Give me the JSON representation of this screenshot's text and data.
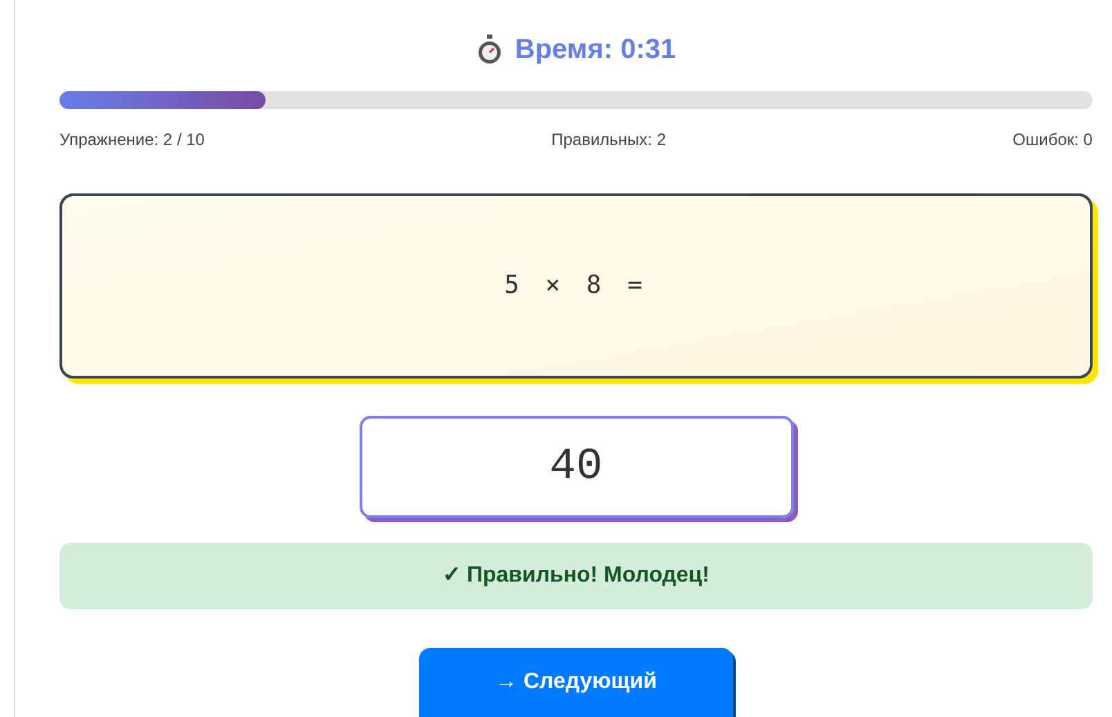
{
  "timer": {
    "text": "Время: 0:31"
  },
  "progress": {
    "level": 0.2
  },
  "stats": [
    "Упражнение: 2 / 10",
    "Правильных: 2",
    "Ошибок: 0"
  ],
  "problem": {
    "text": "5 × 8 ="
  },
  "answer": {
    "value": "40"
  },
  "feedback": {
    "kind": "success",
    "text": "✓ Правильно! Молодец!"
  },
  "next_button": {
    "label": "→ Следующий"
  }
}
